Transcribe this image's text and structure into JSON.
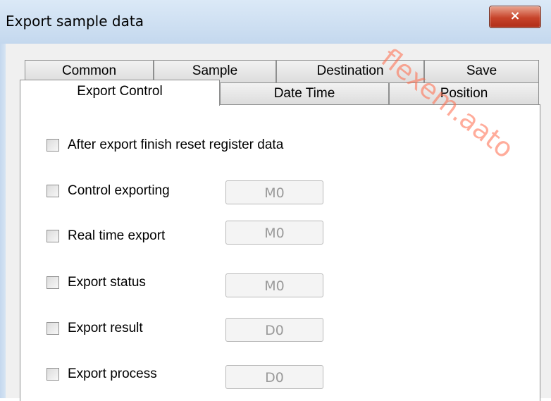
{
  "window": {
    "title": "Export sample data",
    "close_glyph": "×",
    "close_icon": "close-icon"
  },
  "tabs": {
    "row1": [
      "Common",
      "Sample",
      "Destination",
      "Save"
    ],
    "row2": [
      "Export Control",
      "Date Time",
      "Position"
    ],
    "active": "Export Control"
  },
  "options": {
    "reset_after_export": {
      "label": "After export finish reset register data",
      "checked": false
    },
    "control_exporting": {
      "label": "Control exporting",
      "checked": false,
      "address": "M0"
    },
    "real_time_export": {
      "label": "Real time export",
      "checked": false,
      "address": "M0"
    },
    "export_status": {
      "label": "Export status",
      "checked": false,
      "address": "M0"
    },
    "export_result": {
      "label": "Export result",
      "checked": false,
      "address": "D0"
    },
    "export_process": {
      "label": "Export process",
      "checked": false,
      "address": "D0"
    }
  },
  "watermark": {
    "text": "flexem.aato"
  },
  "colors": {
    "titlebar": "#c4d8ee",
    "close_button": "#c7432a",
    "watermark": "#ff6a4a"
  }
}
